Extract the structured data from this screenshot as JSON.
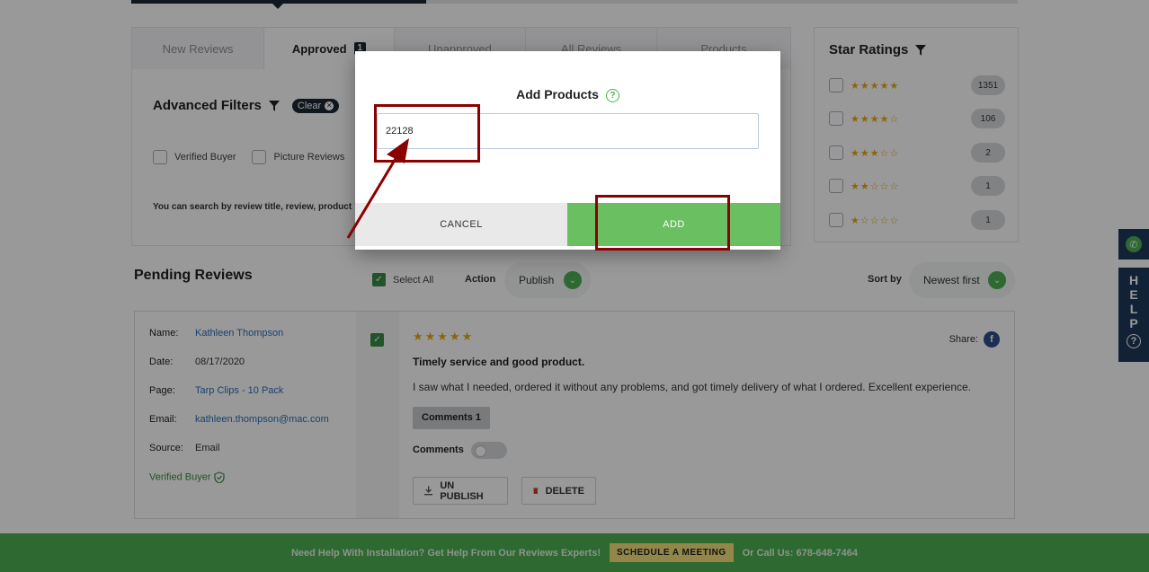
{
  "colors": {
    "accent": "#4caf50",
    "dark": "#1d2733",
    "annotation": "#8b0000",
    "star": "#e6a817"
  },
  "tabs": [
    {
      "label": "New Reviews",
      "active": false
    },
    {
      "label": "Approved",
      "active": true,
      "badge": "1"
    },
    {
      "label": "Unapproved",
      "active": false
    },
    {
      "label": "All Reviews",
      "active": false
    },
    {
      "label": "Products",
      "active": false
    }
  ],
  "filters": {
    "title": "Advanced Filters",
    "clear_label": "Clear",
    "verified_buyer_label": "Verified Buyer",
    "picture_reviews_label": "Picture Reviews",
    "search_hint": "You can search by review title, review, product"
  },
  "star_ratings": {
    "title": "Star Ratings",
    "rows": [
      {
        "stars": "★★★★★",
        "count": "1351"
      },
      {
        "stars": "★★★★☆",
        "count": "106"
      },
      {
        "stars": "★★★☆☆",
        "count": "2"
      },
      {
        "stars": "★★☆☆☆",
        "count": "1"
      },
      {
        "stars": "★☆☆☆☆",
        "count": "1"
      }
    ]
  },
  "pending": {
    "title": "Pending Reviews",
    "select_all_label": "Select All",
    "action_label": "Action",
    "action_value": "Publish",
    "sort_label": "Sort by",
    "sort_value": "Newest first"
  },
  "review": {
    "name_key": "Name:",
    "name": "Kathleen Thompson",
    "date_key": "Date:",
    "date": "08/17/2020",
    "page_key": "Page:",
    "page": "Tarp Clips - 10 Pack",
    "email_key": "Email:",
    "email": "kathleen.thompson@mac.com",
    "source_key": "Source:",
    "source": "Email",
    "verified": "Verified Buyer",
    "stars": "★★★★★",
    "share_label": "Share:",
    "title": "Timely service and good product.",
    "text": "I saw what I needed, ordered it without any problems, and got timely delivery of what I ordered. Excellent experience.",
    "comments_button": "Comments 1",
    "comments_label": "Comments",
    "unpublish_label": "UN PUBLISH",
    "delete_label": "DELETE"
  },
  "footer": {
    "left_text": "Need Help With Installation? Get Help From Our Reviews Experts!",
    "cta": "SCHEDULE A MEETING",
    "right_text": "Or Call Us: 678-648-7464"
  },
  "help_widget": {
    "letters": [
      "H",
      "E",
      "L",
      "P"
    ]
  },
  "modal": {
    "title": "Add Products",
    "input_value": "22128",
    "cancel_label": "CANCEL",
    "add_label": "ADD"
  }
}
